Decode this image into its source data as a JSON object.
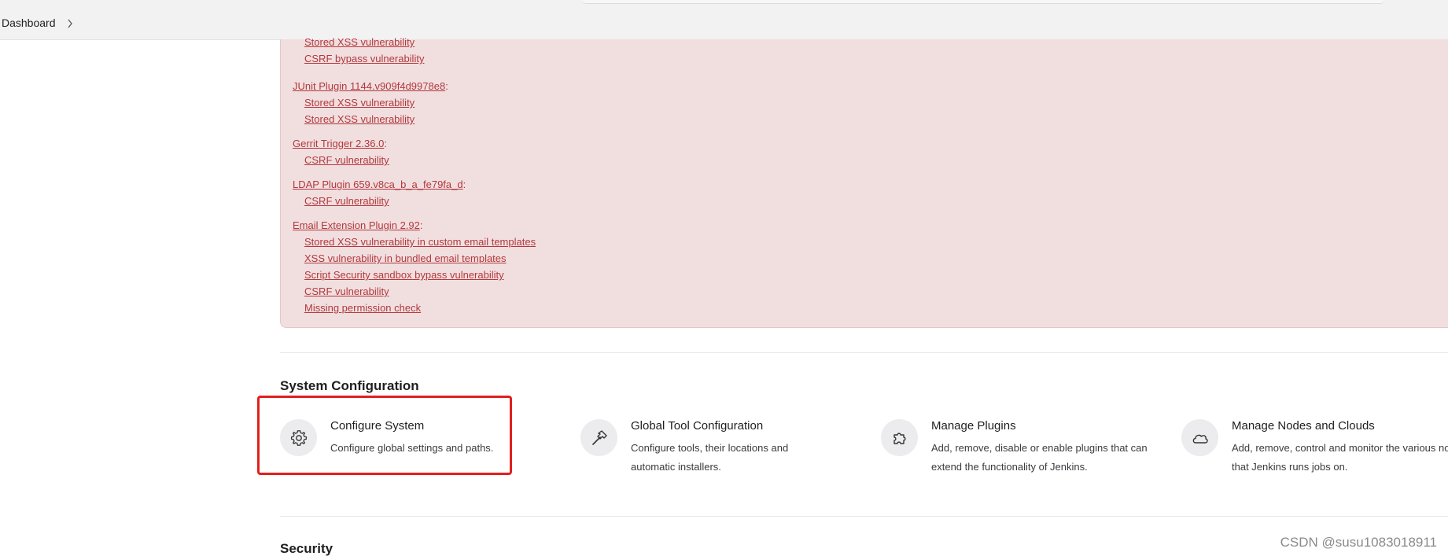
{
  "breadcrumb": {
    "items": [
      "Dashboard"
    ],
    "separator_icon": "chevron-right-icon"
  },
  "warnings": {
    "partial_top_link": "Stored XSS vulnerability",
    "partial_top_link2": "CSRF bypass vulnerability",
    "plugins": [
      {
        "name": "JUnit Plugin 1144.v909f4d9978e8",
        "issues": [
          "Stored XSS vulnerability",
          "Stored XSS vulnerability"
        ]
      },
      {
        "name": "Gerrit Trigger 2.36.0",
        "issues": [
          "CSRF vulnerability"
        ]
      },
      {
        "name": "LDAP Plugin 659.v8ca_b_a_fe79fa_d",
        "issues": [
          "CSRF vulnerability"
        ]
      },
      {
        "name": "Email Extension Plugin 2.92",
        "issues": [
          "Stored XSS vulnerability in custom email templates",
          "XSS vulnerability in bundled email templates",
          "Script Security sandbox bypass vulnerability",
          "CSRF vulnerability",
          "Missing permission check"
        ]
      }
    ],
    "colon": ":"
  },
  "system_configuration": {
    "title": "System Configuration",
    "cards": [
      {
        "title": "Configure System",
        "description": "Configure global settings and paths.",
        "icon": "gear-icon"
      },
      {
        "title": "Global Tool Configuration",
        "description": "Configure tools, their locations and automatic installers.",
        "icon": "hammer-icon"
      },
      {
        "title": "Manage Plugins",
        "description": "Add, remove, disable or enable plugins that can extend the functionality of Jenkins.",
        "icon": "puzzle-icon"
      },
      {
        "title": "Manage Nodes and Clouds",
        "description": "Add, remove, control and monitor the various nodes that Jenkins runs jobs on.",
        "icon": "cloud-icon"
      }
    ]
  },
  "security": {
    "title": "Security"
  },
  "watermark": "CSDN @susu1083018911",
  "colors": {
    "alert_bg": "#f1dfe0",
    "alert_link": "#b3383c",
    "highlight": "#e0201e"
  }
}
